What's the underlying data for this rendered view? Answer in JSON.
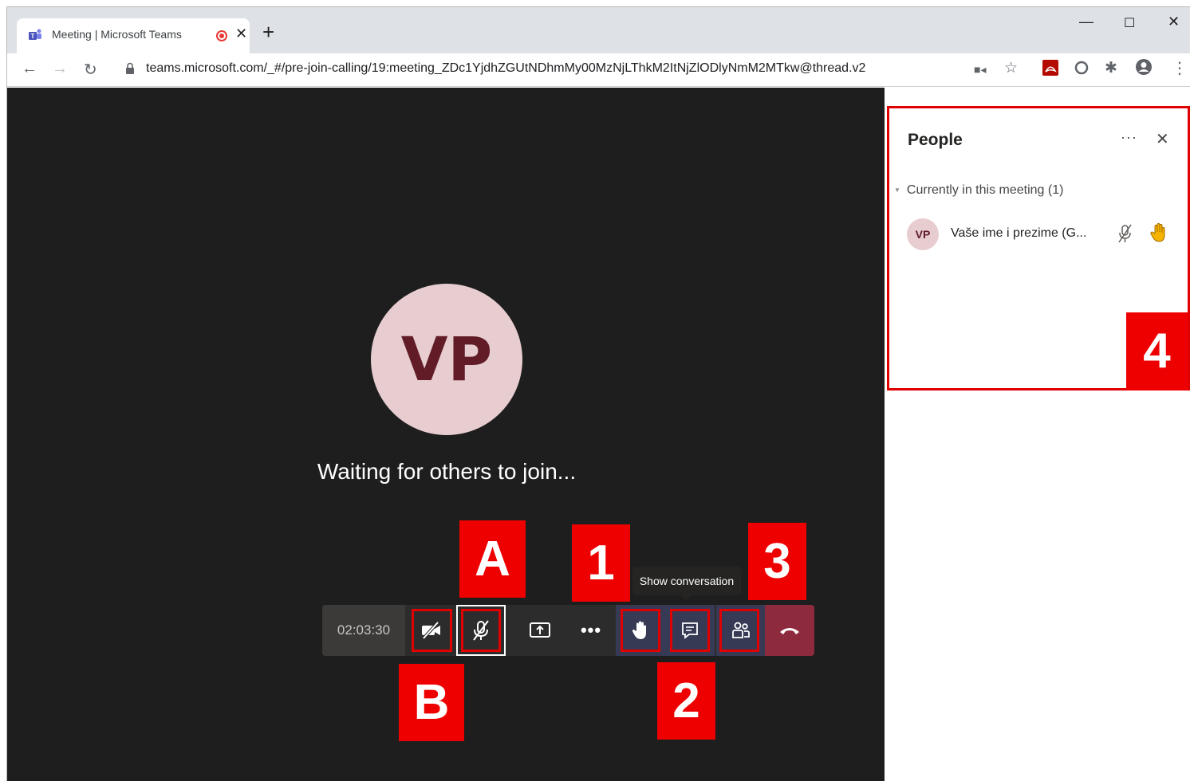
{
  "browser": {
    "tab_title": "Meeting | Microsoft Teams",
    "url": "teams.microsoft.com/_#/pre-join-calling/19:meeting_ZDc1YjdhZGUtNDhmMy00MzNjLThkM2ItNjZlODlyNmM2MTkw@thread.v2"
  },
  "stage": {
    "avatar_initials": "VP",
    "status_text": "Waiting for others to join..."
  },
  "controls": {
    "timer": "02:03:30",
    "tooltip": "Show conversation"
  },
  "callouts": {
    "a": "A",
    "b": "B",
    "one": "1",
    "two": "2",
    "three": "3",
    "four": "4"
  },
  "people": {
    "title": "People",
    "section_label": "Currently in this meeting (1)",
    "participants": [
      {
        "initials": "VP",
        "name": "Vaše ime i prezime (G..."
      }
    ]
  },
  "colors": {
    "stage_bg": "#1f1e1e",
    "avatar_bg": "#e8cdd0",
    "avatar_text": "#611c27",
    "callout_red": "#ee0000",
    "hangup": "#8e2a3d",
    "raise_hand": "#f4b400"
  }
}
